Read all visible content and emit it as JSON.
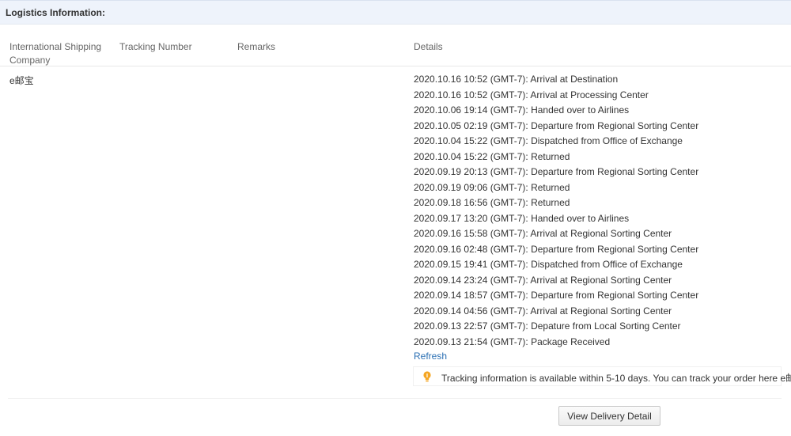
{
  "section": {
    "title": "Logistics Information:"
  },
  "table": {
    "headers": {
      "company": "International Shipping Company",
      "tracking_number": "Tracking Number",
      "remarks": "Remarks",
      "details": "Details"
    },
    "row": {
      "company": "e邮宝",
      "tracking_number": "",
      "remarks": "",
      "events": [
        "2020.10.16 10:52 (GMT-7): Arrival at Destination",
        "2020.10.16 10:52 (GMT-7): Arrival at Processing Center",
        "2020.10.06 19:14 (GMT-7): Handed over to Airlines",
        "2020.10.05 02:19 (GMT-7): Departure from Regional Sorting Center",
        "2020.10.04 15:22 (GMT-7): Dispatched from Office of Exchange",
        "2020.10.04 15:22 (GMT-7): Returned",
        "2020.09.19 20:13 (GMT-7): Departure from Regional Sorting Center",
        "2020.09.19 09:06 (GMT-7): Returned",
        "2020.09.18 16:56 (GMT-7): Returned",
        "2020.09.17 13:20 (GMT-7): Handed over to Airlines",
        "2020.09.16 15:58 (GMT-7): Arrival at Regional Sorting Center",
        "2020.09.16 02:48 (GMT-7): Departure from Regional Sorting Center",
        "2020.09.15 19:41 (GMT-7): Dispatched from Office of Exchange",
        "2020.09.14 23:24 (GMT-7): Arrival at Regional Sorting Center",
        "2020.09.14 18:57 (GMT-7): Departure from Regional Sorting Center",
        "2020.09.14 04:56 (GMT-7): Arrival at Regional Sorting Center",
        "2020.09.13 22:57 (GMT-7): Depature from Local Sorting Center",
        "2020.09.13 21:54 (GMT-7): Package Received"
      ],
      "refresh_label": "Refresh"
    }
  },
  "tip": {
    "icon": "lightbulb-icon",
    "text": "Tracking information is available within 5-10 days. You can track your order here ",
    "link_label": "e邮宝",
    "suffix": ".",
    "icon_color": "#f5a623"
  },
  "delivery_button_label": "View Delivery Detail",
  "colors": {
    "header_bg": "#eef3fb",
    "link": "#2a6fb3"
  }
}
